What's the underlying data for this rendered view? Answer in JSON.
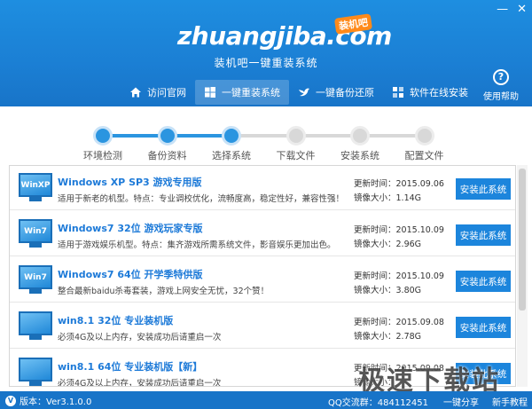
{
  "header": {
    "logo_text": "zhuangjiba.com",
    "logo_badge": "装机吧",
    "subtitle": "装机吧一键重装系统",
    "help_label": "使用帮助",
    "help_glyph": "?",
    "controls": {
      "minimize": "—",
      "close": "✕"
    }
  },
  "nav": {
    "items": [
      {
        "label": "访问官网",
        "icon": "home-icon"
      },
      {
        "label": "一键重装系统",
        "icon": "windows-icon"
      },
      {
        "label": "一键备份还原",
        "icon": "bird-icon"
      },
      {
        "label": "软件在线安装",
        "icon": "apps-icon"
      }
    ],
    "active_index": 1
  },
  "steps": {
    "items": [
      "环境检测",
      "备份资料",
      "选择系统",
      "下载文件",
      "安装系统",
      "配置文件"
    ],
    "completed_count": 3
  },
  "list": {
    "updated_label": "更新时间：",
    "size_label": "镜像大小：",
    "install_label": "安装此系统",
    "rows": [
      {
        "thumb": "WinXP",
        "title": "Windows XP SP3 游戏专用版",
        "desc": "适用于新老的机型。特点：专业调校优化，流畅度高，稳定性好，兼容性强！",
        "date": "2015.09.06",
        "size": "1.14G"
      },
      {
        "thumb": "Win7",
        "title": "Windows7 32位 游戏玩家专版",
        "desc": "适用于游戏娱乐机型。特点：集齐游戏所需系统文件，影音娱乐更加出色。",
        "date": "2015.10.09",
        "size": "2.96G"
      },
      {
        "thumb": "Win7",
        "title": "Windows7 64位 开学季特供版",
        "desc": "整合最新baidu杀毒套装，游戏上网安全无忧，32个赞！",
        "date": "2015.10.09",
        "size": "3.80G"
      },
      {
        "thumb": "",
        "title": "win8.1 32位 专业装机版",
        "desc": "必须4G及以上内存，安装成功后请重启一次",
        "date": "2015.09.08",
        "size": "2.78G"
      },
      {
        "thumb": "",
        "title": "win8.1 64位 专业装机版【新】",
        "desc": "必须4G及以上内存，安装成功后请重启一次",
        "date": "2015.09.08",
        "size": ""
      }
    ]
  },
  "footer": {
    "version": "版本：Ver3.1.0.0",
    "version_glyph": "V",
    "qq": "QQ交流群：484112451",
    "share": "一键分享",
    "tutorial": "新手教程"
  },
  "watermark": "极速下载站",
  "colors": {
    "primary": "#1874c8",
    "accent": "#1c85dc",
    "step_done": "#2b95e0",
    "step_todo": "#d8d8d8"
  }
}
